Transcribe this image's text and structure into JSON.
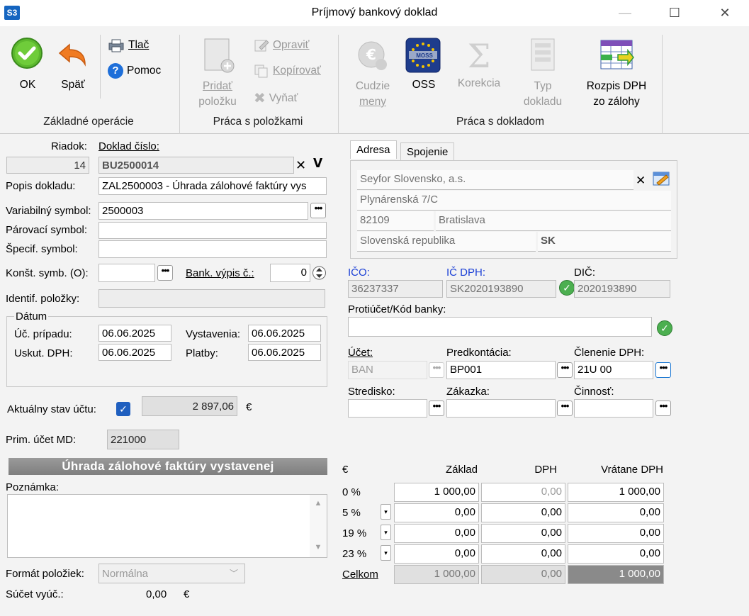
{
  "window": {
    "title": "Príjmový bankový doklad",
    "logo": "S3",
    "minimize": "—",
    "maximize": "☐",
    "close": "✕"
  },
  "ribbon": {
    "ok": "OK",
    "back": "Späť",
    "print": "Tlač",
    "help": "Pomoc",
    "group1": "Základné operácie",
    "add_item_1": "Pridať",
    "add_item_2": "položku",
    "edit": "Opraviť",
    "copy": "Kopírovať",
    "cut": "Vyňať",
    "group2": "Práca s položkami",
    "currency_1": "Cudzie",
    "currency_2": "meny",
    "oss": "OSS",
    "oss_badge": "MOSS",
    "correction": "Korekcia",
    "doctype_1": "Typ",
    "doctype_2": "dokladu",
    "vat_split_1": "Rozpis DPH",
    "vat_split_2": "zo zálohy",
    "group3": "Práca s dokladom"
  },
  "form": {
    "row_label": "Riadok:",
    "row_value": "14",
    "docnum_label": "Doklad číslo:",
    "docnum_value": "BU2500014",
    "desc_label": "Popis dokladu:",
    "desc_value": "ZAL2500003 - Úhrada zálohové faktúry vys",
    "varsym_label": "Variabilný symbol:",
    "varsym_value": "2500003",
    "pairsym_label": "Párovací symbol:",
    "pairsym_value": "",
    "specsym_label": "Špecif. symbol:",
    "specsym_value": "",
    "constsym_label": "Konšt. symb. (O):",
    "constsym_value": "",
    "bankstmt_label": "Bank. výpis č.:",
    "bankstmt_value": "0",
    "itemid_label": "Identif. položky:",
    "itemid_value": "",
    "date_group": "Dátum",
    "case_label": "Úč. prípadu:",
    "case_value": "06.06.2025",
    "issued_label": "Vystavenia:",
    "issued_value": "06.06.2025",
    "vatdate_label": "Uskut. DPH:",
    "vatdate_value": "06.06.2025",
    "payment_label": "Platby:",
    "payment_value": "06.06.2025",
    "balance_label": "Aktuálny stav účtu:",
    "balance_value": "2 897,06",
    "balance_currency": "€",
    "primacc_label": "Prim. účet MD:",
    "primacc_value": "221000",
    "banner": "Úhrada zálohové faktúry vystavenej",
    "note_label": "Poznámka:",
    "note_value": "",
    "itemformat_label": "Formát položiek:",
    "itemformat_value": "Normálna",
    "sum_label": "Súčet vyúč.:",
    "sum_value": "0,00",
    "sum_currency": "€"
  },
  "address": {
    "tab1": "Adresa",
    "tab2": "Spojenie",
    "name": "Seyfor Slovensko, a.s.",
    "street": "Plynárenská 7/C",
    "zip": "82109",
    "city": "Bratislava",
    "country": "Slovenská republika",
    "country_code": "SK"
  },
  "partner": {
    "ico_label": "IČO:",
    "ico_value": "36237337",
    "icdph_label": "IČ DPH:",
    "icdph_value": "SK2020193890",
    "dic_label": "DIČ:",
    "dic_value": "2020193890",
    "counter_label": "Protiúčet/Kód banky:",
    "counter_value": "",
    "account_label": "Účet:",
    "account_value": "BAN",
    "precont_label": "Predkontácia:",
    "precont_value": "BP001",
    "vatsplit_label": "Členenie DPH:",
    "vatsplit_value": "21U 00",
    "center_label": "Stredisko:",
    "center_value": "",
    "order_label": "Zákazka:",
    "order_value": "",
    "activity_label": "Činnosť:",
    "activity_value": ""
  },
  "vat_table": {
    "currency": "€",
    "col_base": "Základ",
    "col_vat": "DPH",
    "col_total": "Vrátane DPH",
    "rows": [
      {
        "rate": "0 %",
        "base": "1 000,00",
        "vat": "0,00",
        "total": "1 000,00"
      },
      {
        "rate": "5 %",
        "base": "0,00",
        "vat": "0,00",
        "total": "0,00"
      },
      {
        "rate": "19 %",
        "base": "0,00",
        "vat": "0,00",
        "total": "0,00"
      },
      {
        "rate": "23 %",
        "base": "0,00",
        "vat": "0,00",
        "total": "0,00"
      }
    ],
    "total_label": "Celkom",
    "total_base": "1 000,00",
    "total_vat": "0,00",
    "total_total": "1 000,00"
  }
}
